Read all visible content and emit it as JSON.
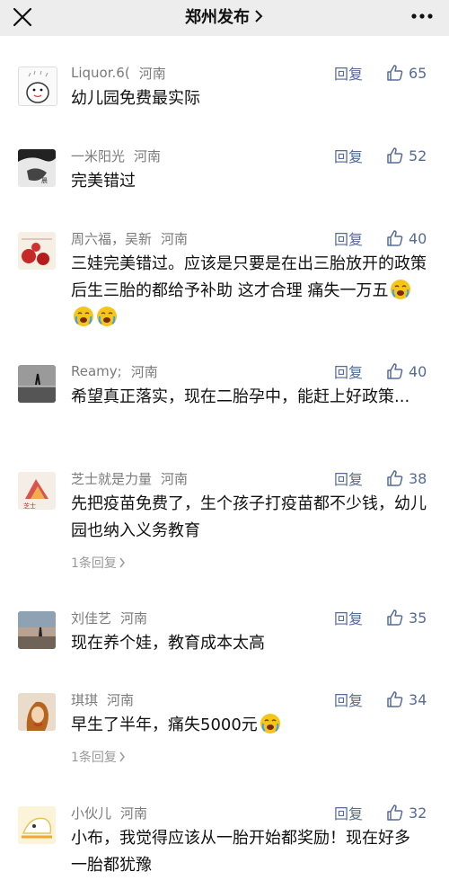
{
  "header": {
    "title": "郑州发布",
    "close_icon": "close-icon",
    "more_icon": "more-dots-icon"
  },
  "reply_label": "回复",
  "comments": [
    {
      "name": "Liquor.6(",
      "region": "河南",
      "likes": "65",
      "text": "幼儿园免费最实际"
    },
    {
      "name": "一米阳光",
      "region": "河南",
      "likes": "52",
      "text": "完美错过"
    },
    {
      "name": "周六福，吴新",
      "region": "河南",
      "likes": "40",
      "text": "三娃完美错过。应该是只要是在出三胎放开的政策后生三胎的都给予补助 这才合理 痛失一万五"
    },
    {
      "name": "Reamy;",
      "region": "河南",
      "likes": "40",
      "text": "希望真正落实，现在二胎孕中，能赶上好政策..."
    },
    {
      "name": "芝士就是力量",
      "region": "河南",
      "likes": "38",
      "text": "先把疫苗免费了，生个孩子打疫苗都不少钱，幼儿园也纳入义务教育",
      "sub_replies": "1条回复"
    },
    {
      "name": "刘佳艺",
      "region": "河南",
      "likes": "35",
      "text": "现在养个娃，教育成本太高"
    },
    {
      "name": "琪琪",
      "region": "河南",
      "likes": "34",
      "text": "早生了半年，痛失5000元",
      "sub_replies": "1条回复"
    },
    {
      "name": "小伙儿",
      "region": "河南",
      "likes": "32",
      "text": "小布，我觉得应该从一胎开始都奖励！现在好多一胎都犹豫"
    }
  ],
  "colors": {
    "link": "#576b95",
    "meta": "#7a7a7a",
    "topbar": "#ededed"
  }
}
